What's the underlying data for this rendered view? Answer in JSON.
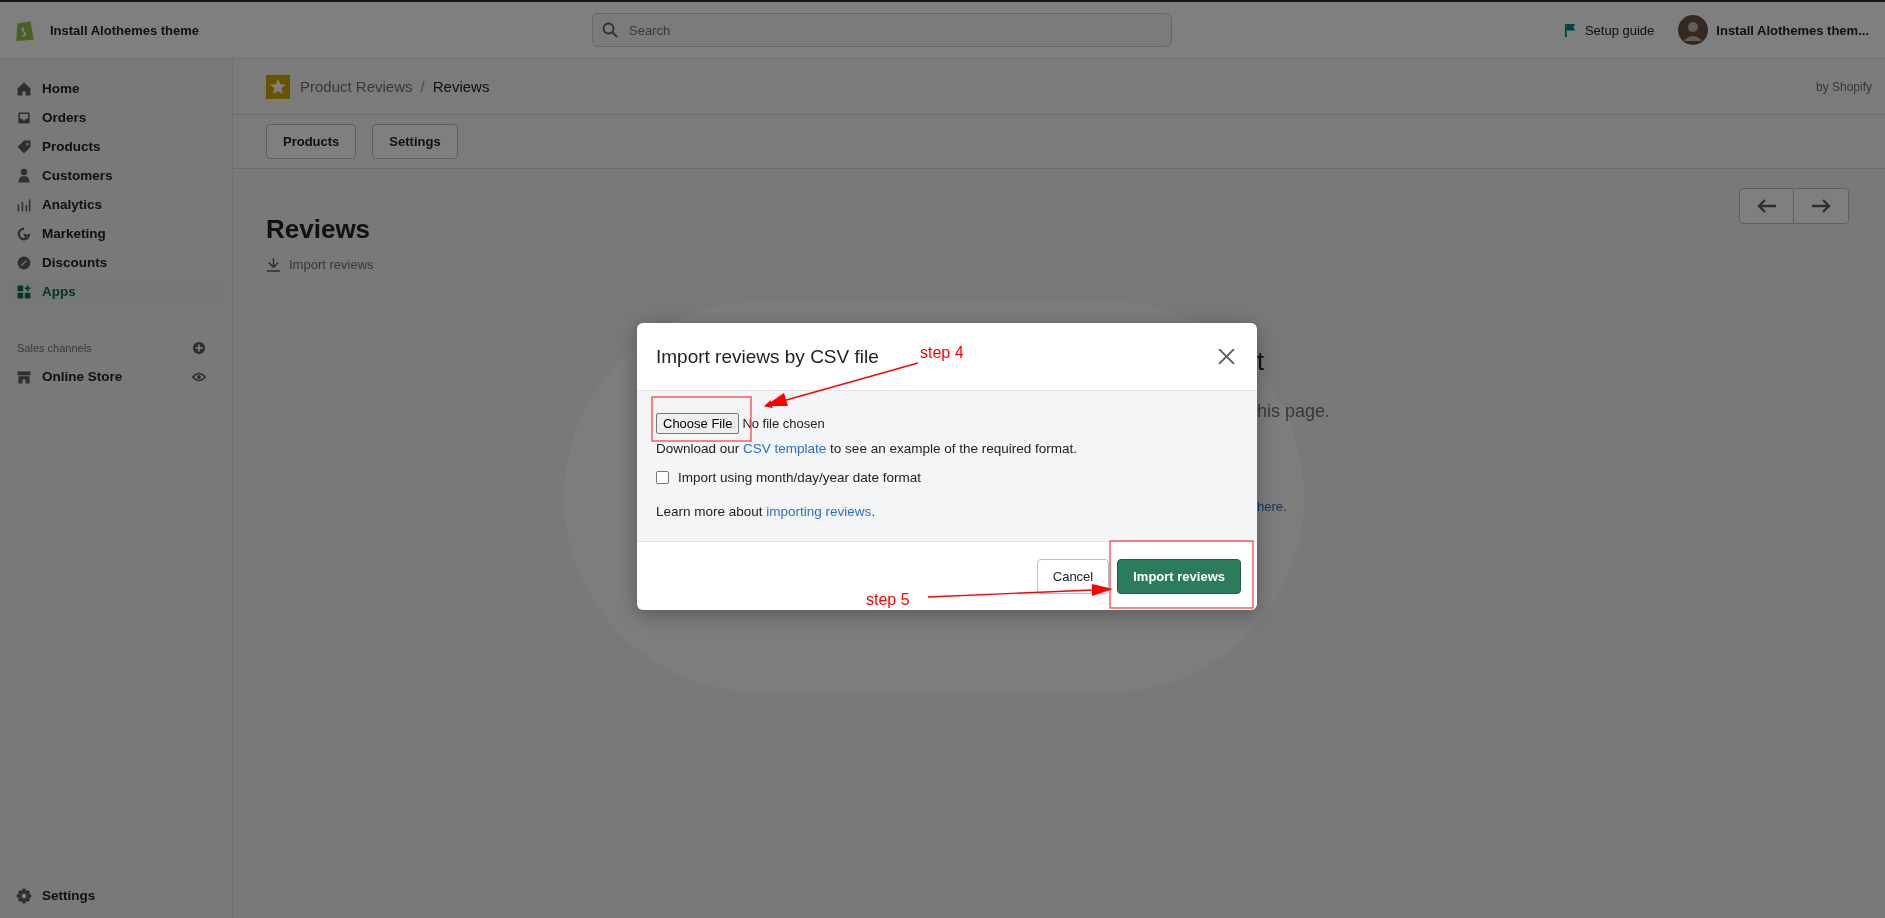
{
  "topbar": {
    "store_name": "Install Alothemes theme",
    "search": {
      "placeholder": "Search"
    },
    "setup_guide": "Setup guide",
    "account_name": "Install Alothemes them..."
  },
  "sidebar": {
    "items": [
      {
        "label": "Home",
        "selected": false
      },
      {
        "label": "Orders",
        "selected": false
      },
      {
        "label": "Products",
        "selected": false
      },
      {
        "label": "Customers",
        "selected": false
      },
      {
        "label": "Analytics",
        "selected": false
      },
      {
        "label": "Marketing",
        "selected": false
      },
      {
        "label": "Discounts",
        "selected": false
      },
      {
        "label": "Apps",
        "selected": true
      }
    ],
    "sales_channels": {
      "heading": "Sales channels",
      "items": [
        {
          "label": "Online Store"
        }
      ]
    },
    "settings": "Settings"
  },
  "app_header": {
    "breadcrumb": {
      "parent": "Product Reviews",
      "separator": "/",
      "current": "Reviews"
    },
    "by": "by Shopify"
  },
  "nav_buttons": [
    {
      "label": "Products"
    },
    {
      "label": "Settings"
    }
  ],
  "page": {
    "title": "Reviews",
    "action": "Import reviews"
  },
  "covered_texts": {
    "heading_end": "t",
    "text_end": "his page.",
    "link_end": "here."
  },
  "modal": {
    "title": "Import reviews by CSV file",
    "file_button": "Choose File",
    "file_status": "No file chosen",
    "download": {
      "before": "Download our ",
      "link": "CSV template",
      "after": " to see an example of the required format."
    },
    "date_option": {
      "label": "Import using month/day/year date format",
      "checked": false
    },
    "learn_more": {
      "before": "Learn more about ",
      "link": "importing reviews",
      "after": "."
    },
    "buttons": [
      {
        "label": "Cancel",
        "kind": "secondary"
      },
      {
        "label": "Import reviews",
        "kind": "primary"
      }
    ]
  },
  "annotations": [
    {
      "label": "step 4"
    },
    {
      "label": "step 5"
    }
  ]
}
